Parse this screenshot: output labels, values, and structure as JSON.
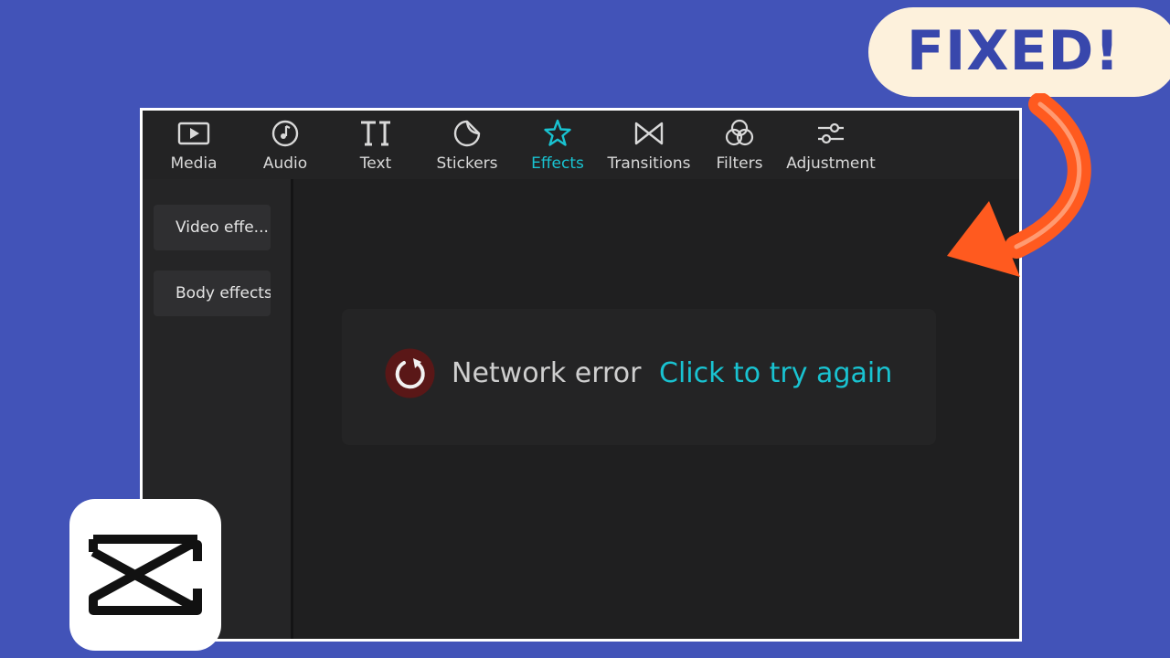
{
  "toolbar": {
    "tabs": [
      {
        "label": "Media",
        "icon": "media-icon"
      },
      {
        "label": "Audio",
        "icon": "audio-icon"
      },
      {
        "label": "Text",
        "icon": "text-icon"
      },
      {
        "label": "Stickers",
        "icon": "stickers-icon"
      },
      {
        "label": "Effects",
        "icon": "effects-icon",
        "active": true
      },
      {
        "label": "Transitions",
        "icon": "transitions-icon"
      },
      {
        "label": "Filters",
        "icon": "filters-icon"
      },
      {
        "label": "Adjustment",
        "icon": "adjustment-icon"
      }
    ]
  },
  "sidebar": {
    "items": [
      {
        "label": "Video effe..."
      },
      {
        "label": "Body effects"
      }
    ]
  },
  "content": {
    "error_message": "Network error",
    "retry_label": "Click to try again",
    "retry_icon": "refresh-icon"
  },
  "overlay": {
    "badge_text": "FIXED!",
    "arrow_icon": "curved-arrow-icon",
    "logo_icon": "capcut-logo-icon"
  },
  "colors": {
    "page_background": "#4253b8",
    "app_background": "#1f1f20",
    "toolbar_background": "#232324",
    "accent": "#19c3d1",
    "badge_background": "#fdf1dc",
    "badge_text": "#3847ac",
    "arrow": "#ff5a1f"
  }
}
